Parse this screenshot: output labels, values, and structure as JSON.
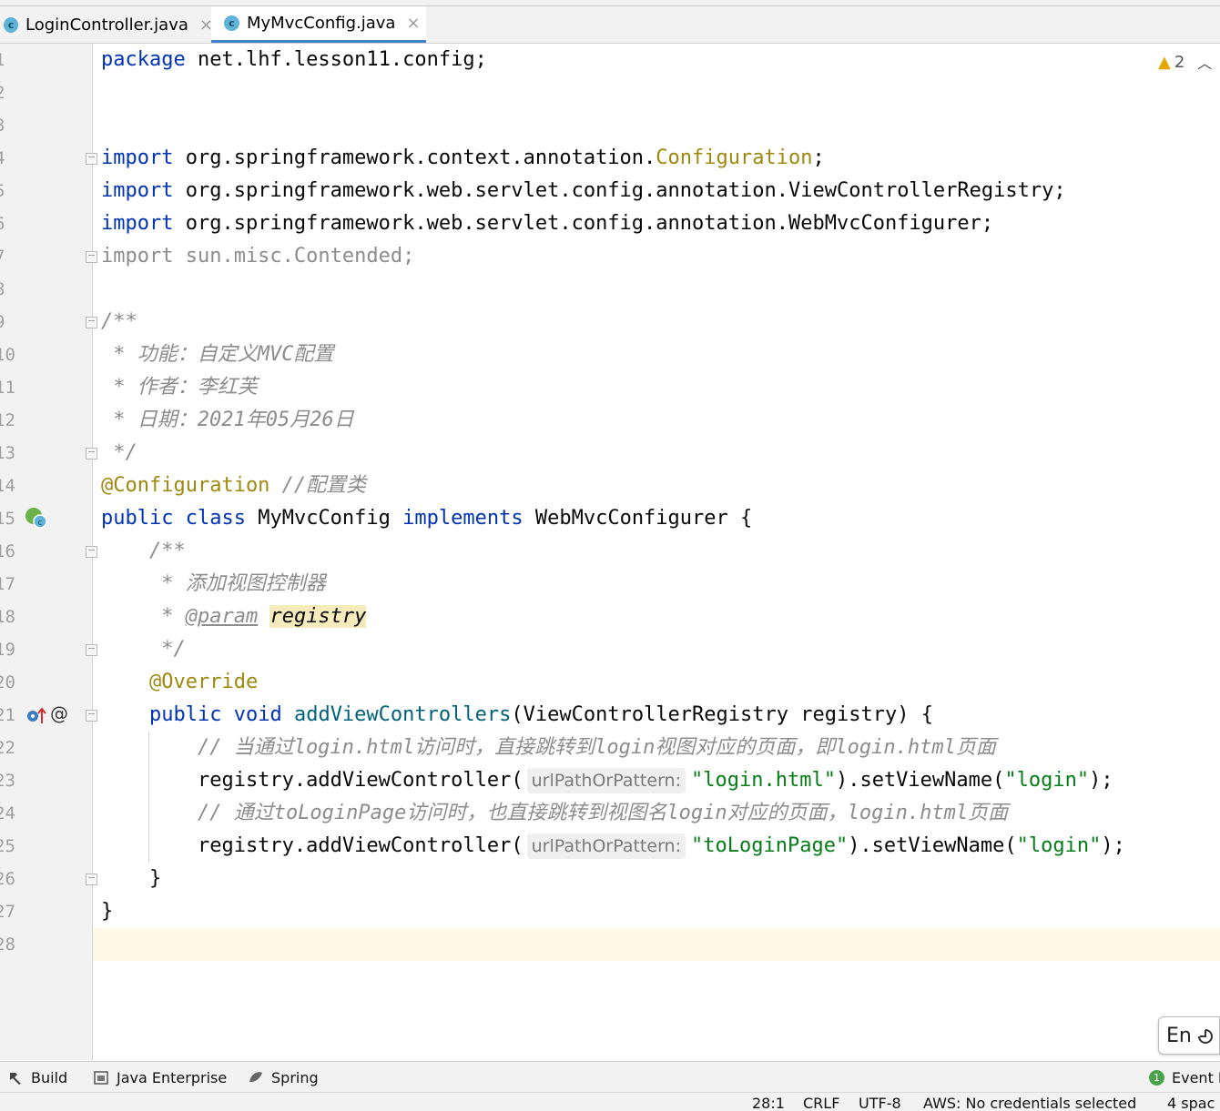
{
  "tabs": [
    {
      "label": "LoginController.java",
      "icon": "class-icon",
      "active": false
    },
    {
      "label": "MyMvcConfig.java",
      "icon": "class-icon",
      "active": true
    }
  ],
  "inspection": {
    "warning_count": "2"
  },
  "editor": {
    "line_numbers": [
      "1",
      "2",
      "3",
      "4",
      "5",
      "6",
      "7",
      "8",
      "9",
      "10",
      "11",
      "12",
      "13",
      "14",
      "15",
      "16",
      "17",
      "18",
      "19",
      "20",
      "21",
      "22",
      "23",
      "24",
      "25",
      "26",
      "27",
      "28"
    ],
    "lines": {
      "l1": {
        "kw": "package",
        "rest": " net.lhf.lesson11.config;"
      },
      "l4": {
        "kw": "import",
        "pre": " org.springframework.context.annotation.",
        "ann": "Configuration",
        "post": ";"
      },
      "l5": {
        "kw": "import",
        "rest": " org.springframework.web.servlet.config.annotation.ViewControllerRegistry;"
      },
      "l6": {
        "kw": "import",
        "rest": " org.springframework.web.servlet.config.annotation.WebMvcConfigurer;"
      },
      "l7": {
        "text": "import sun.misc.Contended;"
      },
      "l9": {
        "text": "/**"
      },
      "l10": {
        "text": " * 功能：自定义MVC配置"
      },
      "l11": {
        "text": " * 作者：李红芙"
      },
      "l12": {
        "text": " * 日期：2021年05月26日"
      },
      "l13": {
        "text": " */"
      },
      "l14": {
        "ann": "@Configuration",
        "cmt": " //配置类"
      },
      "l15": {
        "kw1": "public",
        "kw2": "class",
        "name": " MyMvcConfig ",
        "kw3": "implements",
        "rest": " WebMvcConfigurer {"
      },
      "l16": {
        "text": "    /**"
      },
      "l17": {
        "text": "     * 添加视图控制器"
      },
      "l18": {
        "prefix": "     * ",
        "tag": "@param",
        "param": "registry"
      },
      "l19": {
        "text": "     */"
      },
      "l20": {
        "ann": "    @Override"
      },
      "l21": {
        "indent": "    ",
        "kw1": "public",
        "kw2": "void",
        "method": "addViewControllers",
        "rest": "(ViewControllerRegistry registry) {"
      },
      "l22": {
        "text": "        // 当通过login.html访问时，直接跳转到login视图对应的页面，即login.html页面"
      },
      "l23": {
        "pre": "        registry.addViewController(",
        "hint": "urlPathOrPattern:",
        "s1": "\"login.html\"",
        "mid": ").setViewName(",
        "s2": "\"login\"",
        "post": ");"
      },
      "l24": {
        "text": "        // 通过toLoginPage访问时，也直接跳转到视图名login对应的页面，login.html页面"
      },
      "l25": {
        "pre": "        registry.addViewController(",
        "hint": "urlPathOrPattern:",
        "s1": "\"toLoginPage\"",
        "mid": ").setViewName(",
        "s2": "\"login\"",
        "post": ");"
      },
      "l26": {
        "text": "    }"
      },
      "l27": {
        "text": "}"
      }
    }
  },
  "tool_windows": [
    {
      "label": "Build",
      "icon": "hammer-icon"
    },
    {
      "label": "Java Enterprise",
      "icon": "java-enterprise-icon"
    },
    {
      "label": "Spring",
      "icon": "spring-leaf-icon"
    },
    {
      "label": "Event L",
      "icon": "event-log-icon",
      "badge": "1"
    }
  ],
  "status": {
    "position": "28:1",
    "line_separator": "CRLF",
    "encoding": "UTF-8",
    "aws": "AWS: No credentials selected",
    "indent": "4 spac"
  },
  "ime": {
    "label": "En"
  },
  "colors": {
    "keyword": "#0033b3",
    "annotation": "#9e880d",
    "string": "#067d17",
    "comment": "#8c8c8c",
    "method": "#00627a",
    "accent": "#4083c9"
  }
}
